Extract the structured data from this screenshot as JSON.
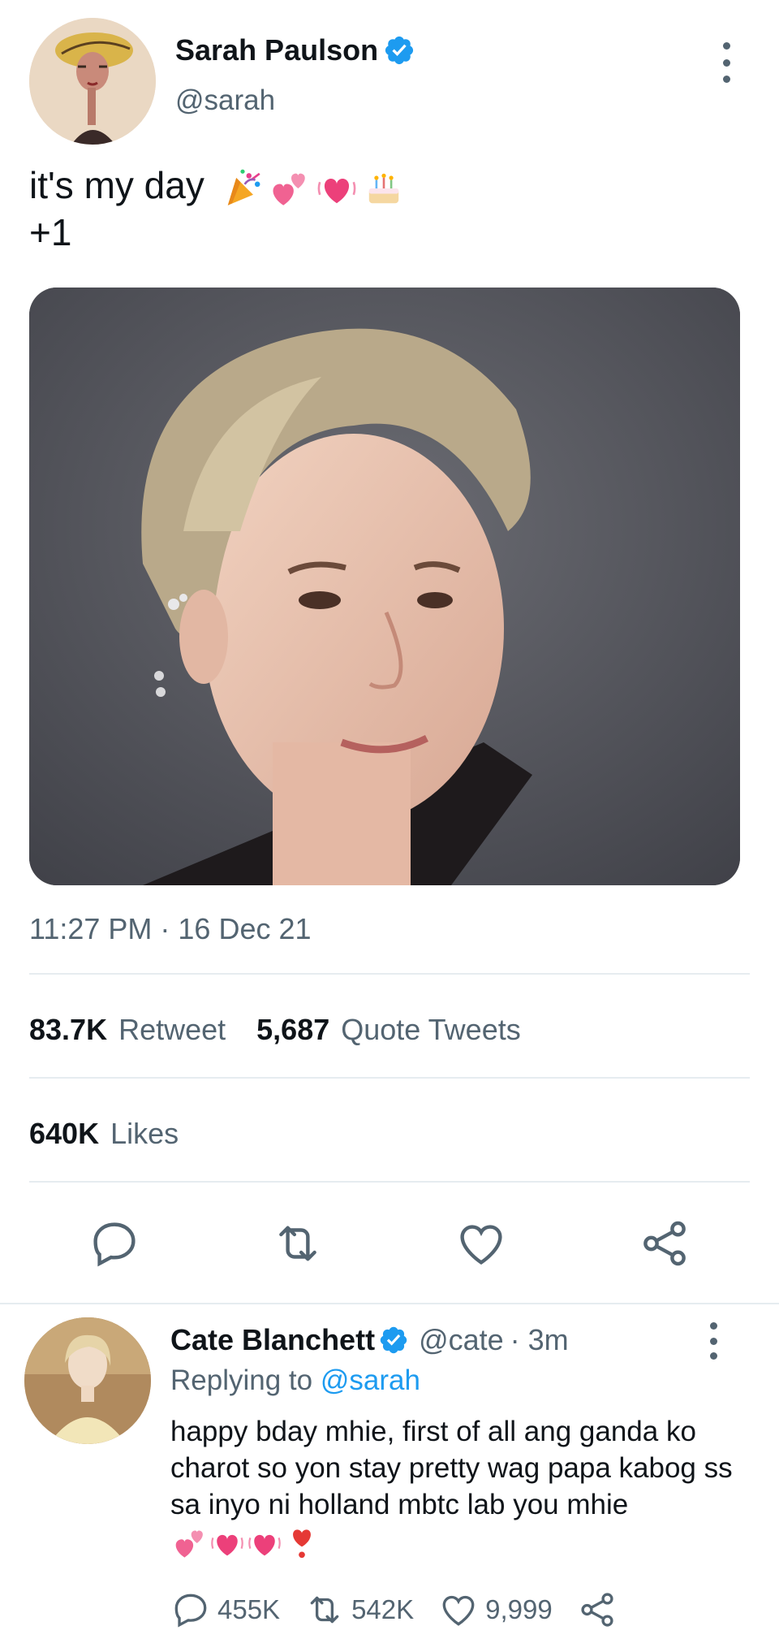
{
  "tweet": {
    "author_name": "Sarah Paulson",
    "author_handle": "@sarah",
    "text_line1": "it's my day",
    "text_line2": "+1",
    "emojis": [
      "party-popper",
      "two-hearts",
      "growing-heart",
      "birthday-cake"
    ],
    "timestamp": "11:27 PM · 16 Dec 21",
    "retweets_count": "83.7K",
    "retweets_label": "Retweet",
    "quotes_count": "5,687",
    "quotes_label": "Quote Tweets",
    "likes_count": "640K",
    "likes_label": "Likes",
    "actions": [
      "reply-icon",
      "retweet-icon",
      "like-icon",
      "share-icon"
    ]
  },
  "reply": {
    "author_name": "Cate Blanchett",
    "author_handle": "@cate",
    "time": "· 3m",
    "replying_prefix": "Replying to",
    "replying_handle": "@sarah",
    "text": "happy bday mhie, first of all ang ganda ko charot so yon stay pretty wag papa kabog ss sa inyo ni holland mbtc lab you mhie",
    "emojis": [
      "two-hearts",
      "growing-heart",
      "growing-heart",
      "heart-exclamation"
    ],
    "reply_count": "455K",
    "retweet_count": "542K",
    "like_count": "9,999"
  },
  "colors": {
    "accent": "#1d9bf0",
    "text": "#0f1419",
    "muted": "#536471",
    "divider": "#e6ecf0"
  }
}
